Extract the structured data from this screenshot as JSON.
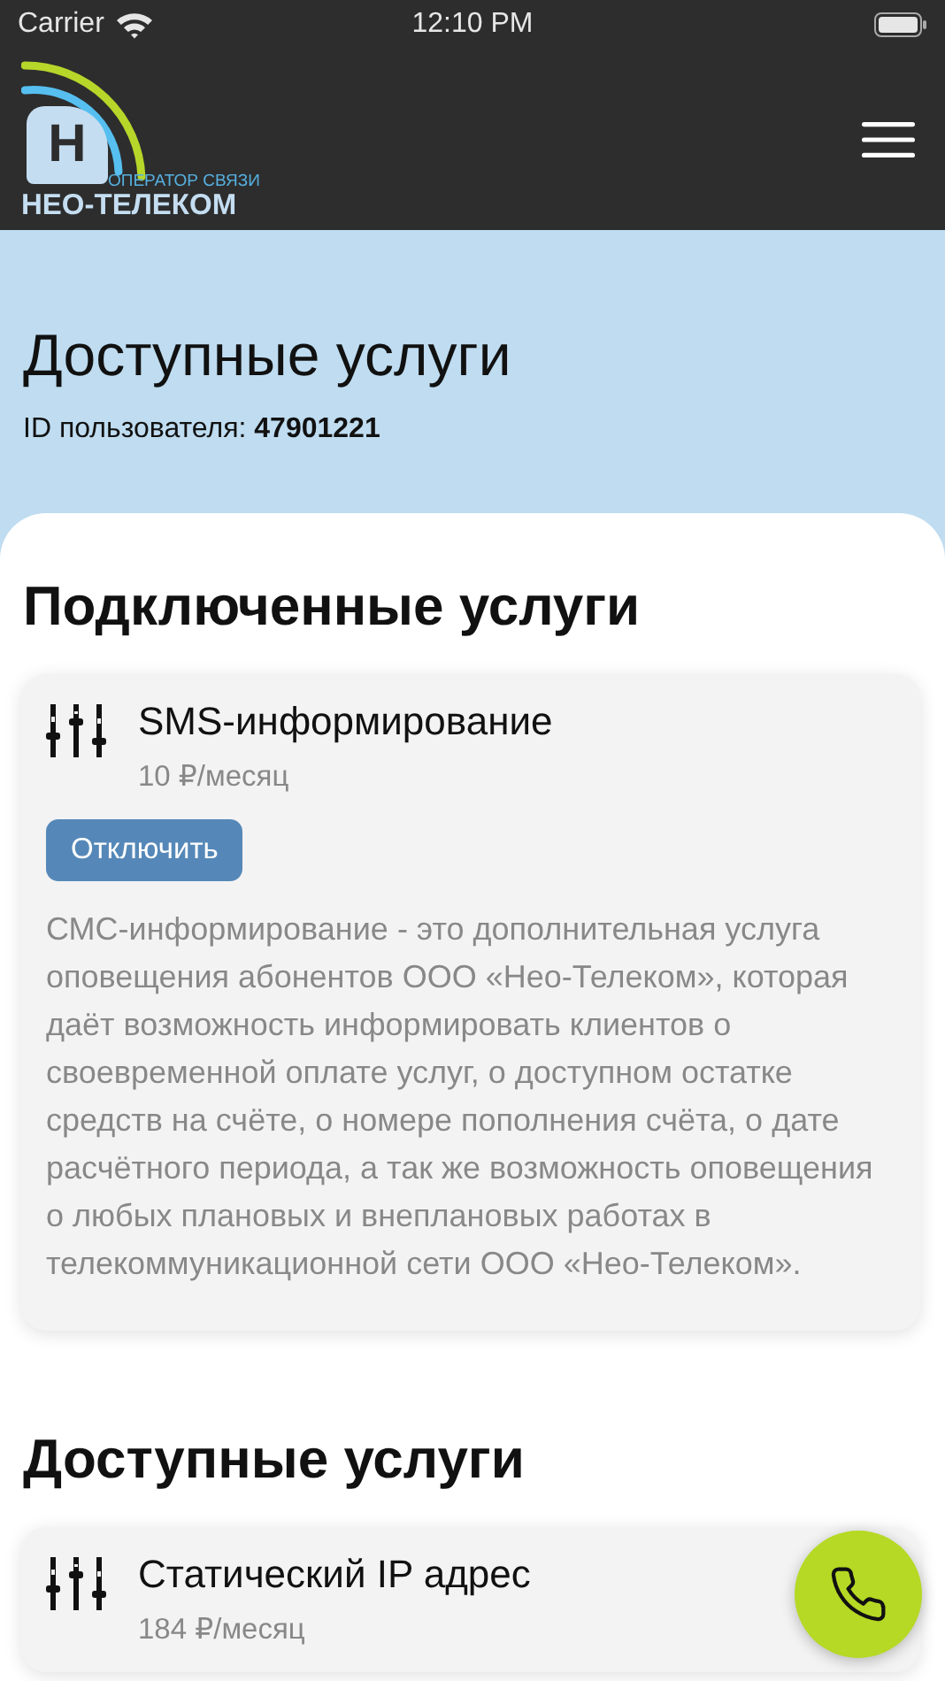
{
  "status_bar": {
    "carrier": "Carrier",
    "time": "12:10 PM"
  },
  "header": {
    "logo": {
      "letter": "Н",
      "tagline": "ОПЕРАТОР СВЯЗИ",
      "name": "НЕО-ТЕЛЕКОМ"
    }
  },
  "page": {
    "title": "Доступные услуги",
    "user_id": "ID пользователя: **47901221**"
  },
  "sections": [
    {
      "title": "Подключенные услуги",
      "services": [
        {
          "name": "SMS-информирование",
          "price": "10 ₽/месяц",
          "button": "Отключить",
          "description": "СМС-информирование - это дополнительная услуга оповещения абонентов ООО «Нео-Телеком», которая даёт возможность информировать клиентов о своевременной оплате услуг, о доступном остатке средств на счёте, о номере пополнения счёта, о дате расчётного периода, а так же возможность оповещения о любых плановых и внеплановых работах в телекоммуникационной сети ООО «Нео-Телеком»."
        }
      ]
    },
    {
      "title": "Доступные услуги",
      "services": [
        {
          "name": "Статический IP адрес",
          "price": "184 ₽/месяц"
        }
      ]
    }
  ]
}
